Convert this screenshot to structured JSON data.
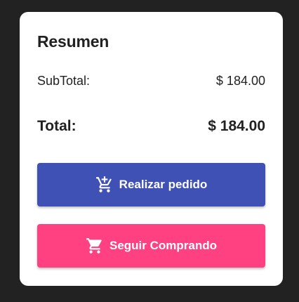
{
  "summary": {
    "title": "Resumen",
    "subtotal_label": "SubTotal:",
    "subtotal_value": "$ 184.00",
    "total_label": "Total:",
    "total_value": "$ 184.00"
  },
  "actions": {
    "place_order": {
      "label": "Realizar pedido",
      "icon": "add-shopping-cart-icon",
      "color": "#3f51b5"
    },
    "continue_shopping": {
      "label": "Seguir Comprando",
      "icon": "shopping-cart-icon",
      "color": "#ff4081"
    }
  },
  "colors": {
    "background": "#222222",
    "card": "#ffffff",
    "text": "#212121"
  }
}
